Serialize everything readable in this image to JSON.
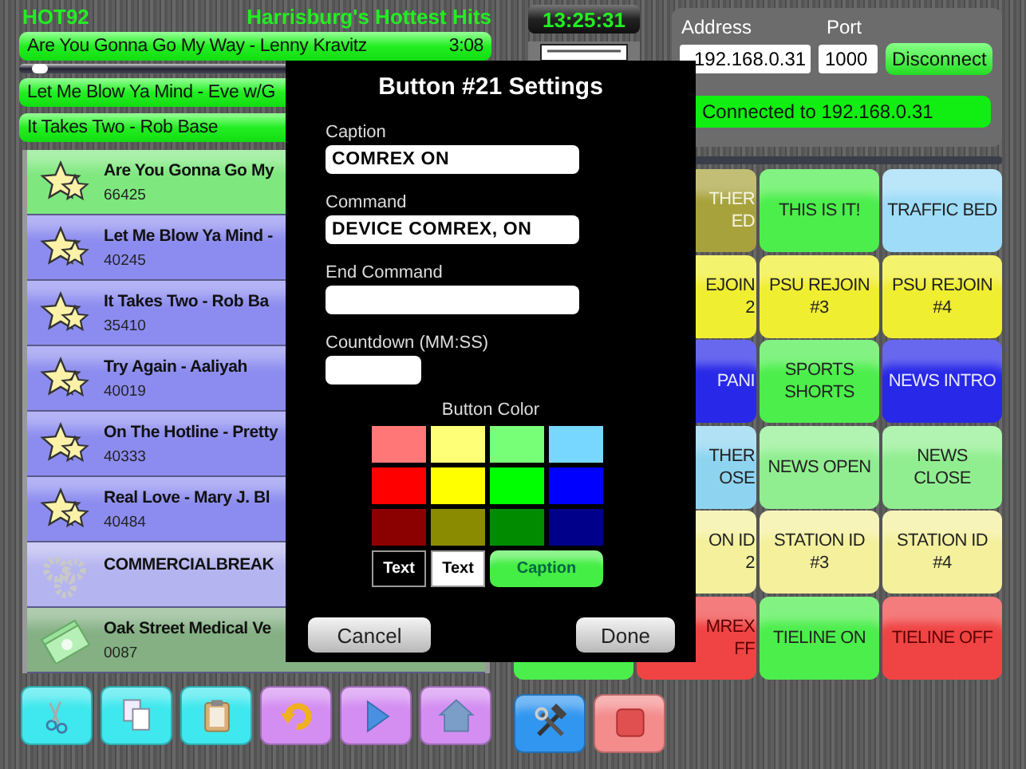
{
  "header": {
    "station": "HOT92",
    "slogan": "Harrisburg's Hottest Hits"
  },
  "now_playing": [
    {
      "title": "Are You Gonna Go My Way - Lenny Kravitz",
      "time": "3:08"
    },
    {
      "title": "Let Me Blow Ya Mind - Eve w/G"
    },
    {
      "title": "It Takes Two - Rob Base"
    }
  ],
  "progress": {
    "level": 0.03
  },
  "playlist": [
    {
      "kind": "song",
      "title": "Are You Gonna Go My",
      "number": "66425",
      "color": "#7ee87e"
    },
    {
      "kind": "song",
      "title": "Let Me Blow Ya Mind -",
      "number": "40245",
      "color": "#8c8cf0"
    },
    {
      "kind": "song",
      "title": "It Takes Two - Rob Ba",
      "number": "35410",
      "color": "#8c8cf0"
    },
    {
      "kind": "song",
      "title": "Try Again - Aaliyah",
      "number": "40019",
      "color": "#8c8cf0"
    },
    {
      "kind": "song",
      "title": "On The Hotline - Pretty",
      "number": "40333",
      "color": "#8c8cf0"
    },
    {
      "kind": "song",
      "title": "Real Love - Mary J. Bl",
      "number": "40484",
      "color": "#8c8cf0"
    },
    {
      "kind": "break",
      "title": "COMMERCIALBREAK",
      "color": "#b4b4f0"
    },
    {
      "kind": "sponsor",
      "title": "Oak Street Medical Ve",
      "number": "0087",
      "color": "#84b084"
    }
  ],
  "toolbar_left": [
    {
      "kind": "cut",
      "color": "#3ee8ee"
    },
    {
      "kind": "copy",
      "color": "#3ee8ee"
    },
    {
      "kind": "paste",
      "color": "#3ee8ee"
    },
    {
      "kind": "undo",
      "color": "#d48ef2"
    },
    {
      "kind": "play",
      "color": "#d48ef2"
    },
    {
      "kind": "home",
      "color": "#d48ef2"
    }
  ],
  "clock": "13:25:31",
  "connection": {
    "address_label": "Address",
    "port_label": "Port",
    "address": "192.168.0.31",
    "port": "1000",
    "button": "Disconnect",
    "status": "Connected to 192.168.0.31"
  },
  "button_grid": [
    [
      {
        "caption": "THER\nED",
        "color": "#a8a23c"
      },
      {
        "caption": "THIS IS IT!",
        "color": "#4cee4c"
      },
      {
        "caption": "TRAFFIC BED",
        "color": "#9edcf8"
      }
    ],
    [
      {
        "caption": "EJOIN\n2",
        "color": "#f0ee30"
      },
      {
        "caption": "PSU REJOIN\n#3",
        "color": "#f0ee30"
      },
      {
        "caption": "PSU REJOIN\n#4",
        "color": "#f0ee30"
      }
    ],
    [
      {
        "caption": "PANI",
        "color": "#2828e8"
      },
      {
        "caption": "SPORTS\nSHORTS",
        "color": "#4cee4c"
      },
      {
        "caption": "NEWS INTRO",
        "color": "#2828e8"
      }
    ],
    [
      {
        "caption": "THER\nOSE",
        "color": "#8ed4f0"
      },
      {
        "caption": "NEWS OPEN",
        "color": "#90ee90"
      },
      {
        "caption": "NEWS\nCLOSE",
        "color": "#90ee90"
      }
    ],
    [
      {
        "caption": "ON ID\n2",
        "color": "#f4f09c"
      },
      {
        "caption": "STATION ID\n#3",
        "color": "#f4f09c"
      },
      {
        "caption": "STATION ID\n#4",
        "color": "#f4f09c"
      }
    ],
    [
      {
        "color": "#4cee4c"
      },
      {
        "caption": "MREX\nFF",
        "color": "#f04444"
      },
      {
        "caption": "TIELINE ON",
        "color": "#4cee4c"
      },
      {
        "caption": "TIELINE OFF",
        "color": "#f04444"
      }
    ]
  ],
  "toolbar_right": [
    {
      "kind": "tools",
      "color": "#3096f0"
    },
    {
      "kind": "stop",
      "color": "#f48c8c"
    }
  ],
  "dialog": {
    "title": "Button #21 Settings",
    "fields": [
      {
        "label": "Caption",
        "value": "COMREX ON"
      },
      {
        "label": "Command",
        "value": "DEVICE COMREX, ON"
      },
      {
        "label": "End Command"
      },
      {
        "label": "Countdown (MM:SS)",
        "kind": "short"
      }
    ],
    "color_label": "Button Color",
    "swatches": [
      {
        "color": "#ff7777"
      },
      {
        "color": "#ffff77"
      },
      {
        "color": "#77ff77"
      },
      {
        "color": "#77d7ff"
      },
      {
        "color": "#ff0000"
      },
      {
        "color": "#ffff00"
      },
      {
        "color": "#00ff00"
      },
      {
        "color": "#0000ff"
      },
      {
        "color": "#8b0000"
      },
      {
        "color": "#8b8b00"
      },
      {
        "color": "#008b00"
      },
      {
        "color": "#00008b"
      }
    ],
    "text_colors": [
      {
        "label": "Text",
        "color": "#000000"
      },
      {
        "label": "Text",
        "color": "#ffffff"
      }
    ],
    "preview": {
      "label": "Caption",
      "color": "#44ee44"
    },
    "buttons": [
      "Cancel",
      "Done"
    ]
  }
}
